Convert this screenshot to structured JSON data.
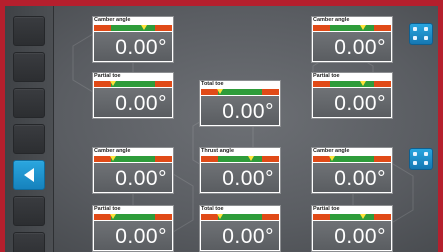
{
  "panels": [
    {
      "label": "Camber angle",
      "value": "0.00°",
      "marker": 0.64
    },
    {
      "label": "Camber angle",
      "value": "0.00°",
      "marker": 0.64
    },
    {
      "label": "Partial toe",
      "value": "0.00°",
      "marker": 0.24
    },
    {
      "label": "Total toe",
      "value": "0.00°",
      "marker": 0.24
    },
    {
      "label": "Partial toe",
      "value": "0.00°",
      "marker": 0.64
    },
    {
      "label": "Camber angle",
      "value": "0.00°",
      "marker": 0.24
    },
    {
      "label": "Thrust angle",
      "value": "0.00°",
      "marker": 0.64
    },
    {
      "label": "Camber angle",
      "value": "0.00°",
      "marker": 0.24
    },
    {
      "label": "Partial toe",
      "value": "0.00°",
      "marker": 0.24
    },
    {
      "label": "Total toe",
      "value": "0.00°",
      "marker": 0.24
    },
    {
      "label": "Partial toe",
      "value": "0.00°",
      "marker": 0.64
    }
  ],
  "sidebar": {
    "buttons": [
      "",
      "",
      "",
      "",
      "",
      "",
      "back",
      "",
      ""
    ]
  },
  "colors": {
    "frame": "#b51f2d",
    "accent": "#1e90cf",
    "bar_red": "#e04a17",
    "bar_green": "#2e9c3a",
    "marker": "#ffe13a"
  },
  "icons": [
    "back-arrow-icon",
    "front-sensor-icon",
    "rear-sensor-icon"
  ]
}
